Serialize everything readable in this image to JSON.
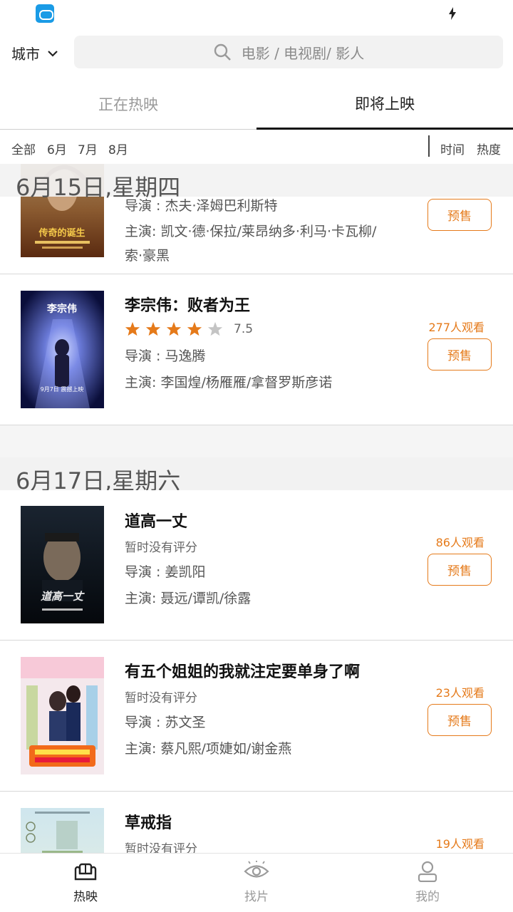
{
  "header": {
    "city_label": "城市",
    "search_placeholder": "电影 / 电视剧/ 影人"
  },
  "tabs": [
    {
      "label": "正在热映",
      "active": false
    },
    {
      "label": "即将上映",
      "active": true
    }
  ],
  "filters": {
    "months": [
      "全部",
      "6月",
      "7月",
      "8月"
    ],
    "sort": [
      "时间",
      "热度"
    ]
  },
  "sections": [
    {
      "date": "6月15日,星期四",
      "movies": [
        {
          "title": "",
          "director": "导演 : 杰夫·泽姆巴利斯特",
          "cast": "主演: 凯文·德·保拉/莱昂纳多·利马·卡瓦柳/",
          "cast_cont": "索·豪黑",
          "poster_text": "传奇的诞生",
          "presale": "预售"
        },
        {
          "title": "李宗伟：败者为王",
          "rating": 7.5,
          "rating_label": "7.5",
          "stars": 4,
          "director": "导演 : 马逸腾",
          "cast": "主演: 李国煌/杨雁雁/拿督罗斯彦诺",
          "watchers": "277人观看",
          "poster_text": "李宗伟",
          "poster_date": "9月7日 震撼上映",
          "presale": "预售"
        }
      ]
    },
    {
      "date": "6月17日,星期六",
      "movies": [
        {
          "title": "道高一丈",
          "rating_label": "暂时没有评分",
          "director": "导演 : 姜凯阳",
          "cast": "主演: 聂远/谭凯/徐露",
          "watchers": "86人观看",
          "poster_text": "道高一丈",
          "presale": "预售"
        },
        {
          "title": "有五个姐姐的我就注定要单身了啊",
          "rating_label": "暂时没有评分",
          "director": "导演 : 苏文圣",
          "cast": "主演: 蔡凡熙/项婕如/谢金燕",
          "watchers": "23人观看",
          "presale": "预售"
        },
        {
          "title": "草戒指",
          "rating_label": "暂时没有评分",
          "watchers": "19人观看"
        }
      ]
    }
  ],
  "bottom_nav": [
    {
      "label": "热映",
      "icon": "sofa-icon",
      "active": true
    },
    {
      "label": "找片",
      "icon": "eye-icon",
      "active": false
    },
    {
      "label": "我的",
      "icon": "person-icon",
      "active": false
    }
  ],
  "colors": {
    "accent": "#e57a1a",
    "active_text": "#222222",
    "inactive_text": "#9a9a9a"
  }
}
